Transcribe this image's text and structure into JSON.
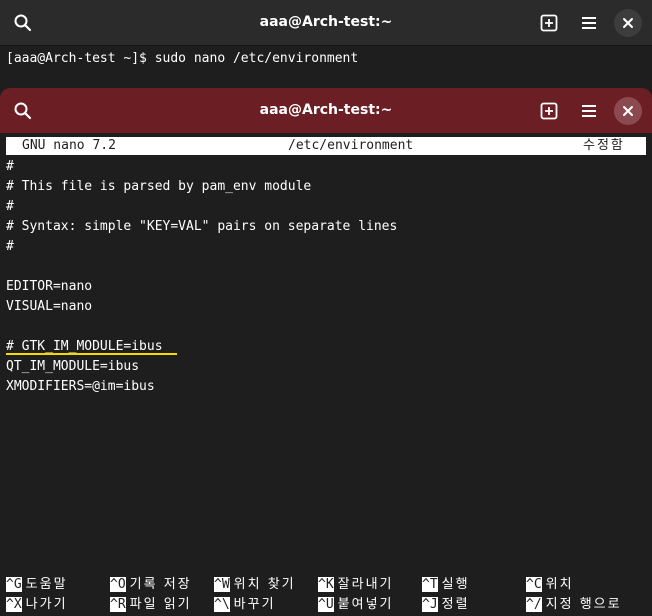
{
  "back_window": {
    "title": "aaa@Arch-test:~",
    "command_line": "[aaa@Arch-test ~]$ sudo nano /etc/environment"
  },
  "front_window": {
    "title": "aaa@Arch-test:~",
    "nano": {
      "version": "GNU nano 7.2",
      "filename": "/etc/environment",
      "status": "수정함",
      "lines": [
        "#",
        "# This file is parsed by pam_env module",
        "#",
        "# Syntax: simple \"KEY=VAL\" pairs on separate lines",
        "#",
        "",
        "EDITOR=nano",
        "VISUAL=nano",
        "",
        "# GTK_IM_MODULE=ibus",
        "QT_IM_MODULE=ibus",
        "XMODIFIERS=@im=ibus"
      ],
      "shortcuts_row1": [
        {
          "key": "^G",
          "label": "도움말"
        },
        {
          "key": "^O",
          "label": "기록 저장"
        },
        {
          "key": "^W",
          "label": "위치 찾기"
        },
        {
          "key": "^K",
          "label": "잘라내기"
        },
        {
          "key": "^T",
          "label": "실행"
        },
        {
          "key": "^C",
          "label": "위치"
        }
      ],
      "shortcuts_row2": [
        {
          "key": "^X",
          "label": "나가기"
        },
        {
          "key": "^R",
          "label": "파일 읽기"
        },
        {
          "key": "^\\",
          "label": "바꾸기"
        },
        {
          "key": "^U",
          "label": "붙여넣기"
        },
        {
          "key": "^J",
          "label": "정렬"
        },
        {
          "key": "^/",
          "label": "지정 행으로"
        }
      ]
    }
  },
  "colors": {
    "back_headerbar": "#2b2b2b",
    "front_headerbar": "#6b1f24",
    "terminal_bg": "#1e1e1e",
    "highlight_underline": "#f5d800"
  },
  "icons": [
    "search-icon",
    "new-tab-icon",
    "hamburger-menu-icon",
    "close-icon"
  ]
}
